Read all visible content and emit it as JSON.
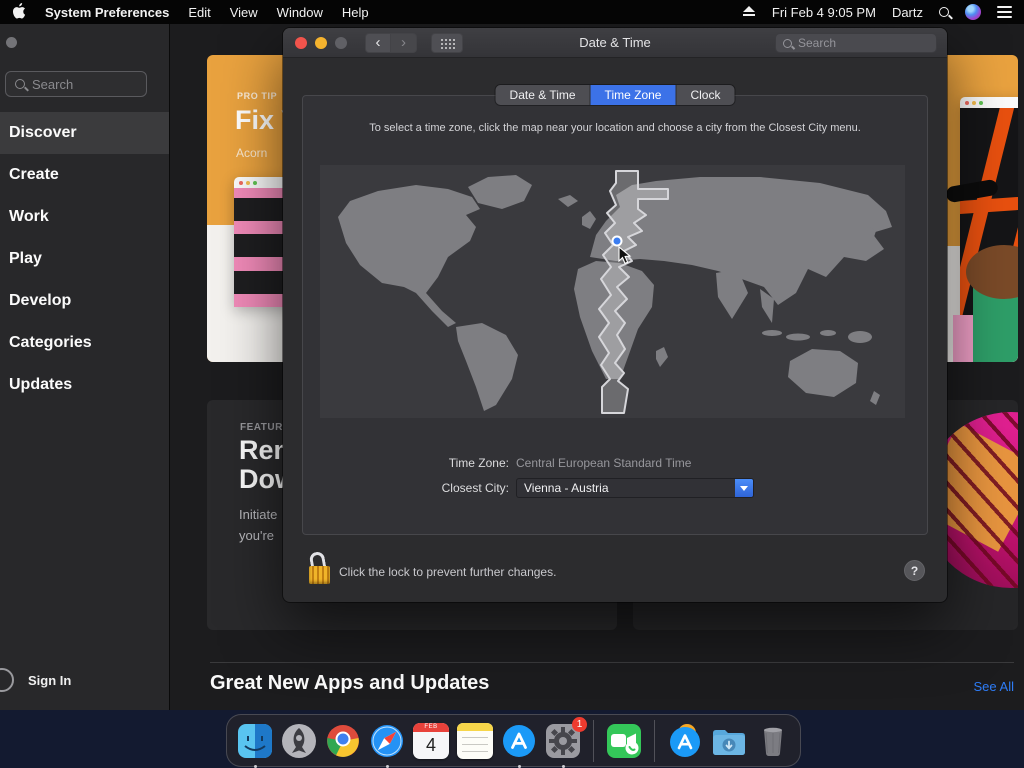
{
  "menu_bar": {
    "app_name": "System Preferences",
    "menus": [
      "Edit",
      "View",
      "Window",
      "Help"
    ],
    "clock": "Fri Feb 4  9:05 PM",
    "user": "Dartz"
  },
  "app_store": {
    "sidebar": {
      "search_placeholder": "Search",
      "items": [
        {
          "label": "Discover",
          "selected": true
        },
        {
          "label": "Create"
        },
        {
          "label": "Work"
        },
        {
          "label": "Play"
        },
        {
          "label": "Develop"
        },
        {
          "label": "Categories"
        },
        {
          "label": "Updates"
        }
      ],
      "sign_in": "Sign In"
    },
    "cards": {
      "pro_tip": {
        "eyebrow": "PRO TIP",
        "title": "Fix Y",
        "subtitle": "Acorn"
      },
      "featured": {
        "eyebrow": "FEATURED",
        "title_line1": "Remo",
        "title_line2": "Down",
        "body_line1": "Initiate",
        "body_line2": "you're"
      }
    },
    "section_heading": "Great New Apps and Updates",
    "see_all": "See All"
  },
  "window": {
    "title": "Date & Time",
    "search_placeholder": "Search",
    "tabs": [
      {
        "label": "Date & Time",
        "selected": false
      },
      {
        "label": "Time Zone",
        "selected": true
      },
      {
        "label": "Clock",
        "selected": false
      }
    ],
    "instruction": "To select a time zone, click the map near your location and choose a city from the Closest City menu.",
    "fields": {
      "time_zone_label": "Time Zone:",
      "time_zone_value": "Central European Standard Time",
      "closest_city_label": "Closest City:",
      "closest_city_value": "Vienna - Austria"
    },
    "lock_text": "Click the lock to prevent further changes.",
    "help_label": "?"
  },
  "dock": {
    "calendar_month": "FEB",
    "calendar_day": "4",
    "badge": "1",
    "items": [
      "finder",
      "launchpad",
      "chrome",
      "safari",
      "calendar",
      "notes",
      "app-store",
      "system-preferences",
      "facetime",
      "applications",
      "downloads",
      "trash"
    ]
  },
  "colors": {
    "selected_tab_blue": "#3c72e8",
    "link_blue": "#2e7cf6",
    "card_orange": "#e9a23f",
    "dropdown_button_blue": "#2f64d8"
  }
}
